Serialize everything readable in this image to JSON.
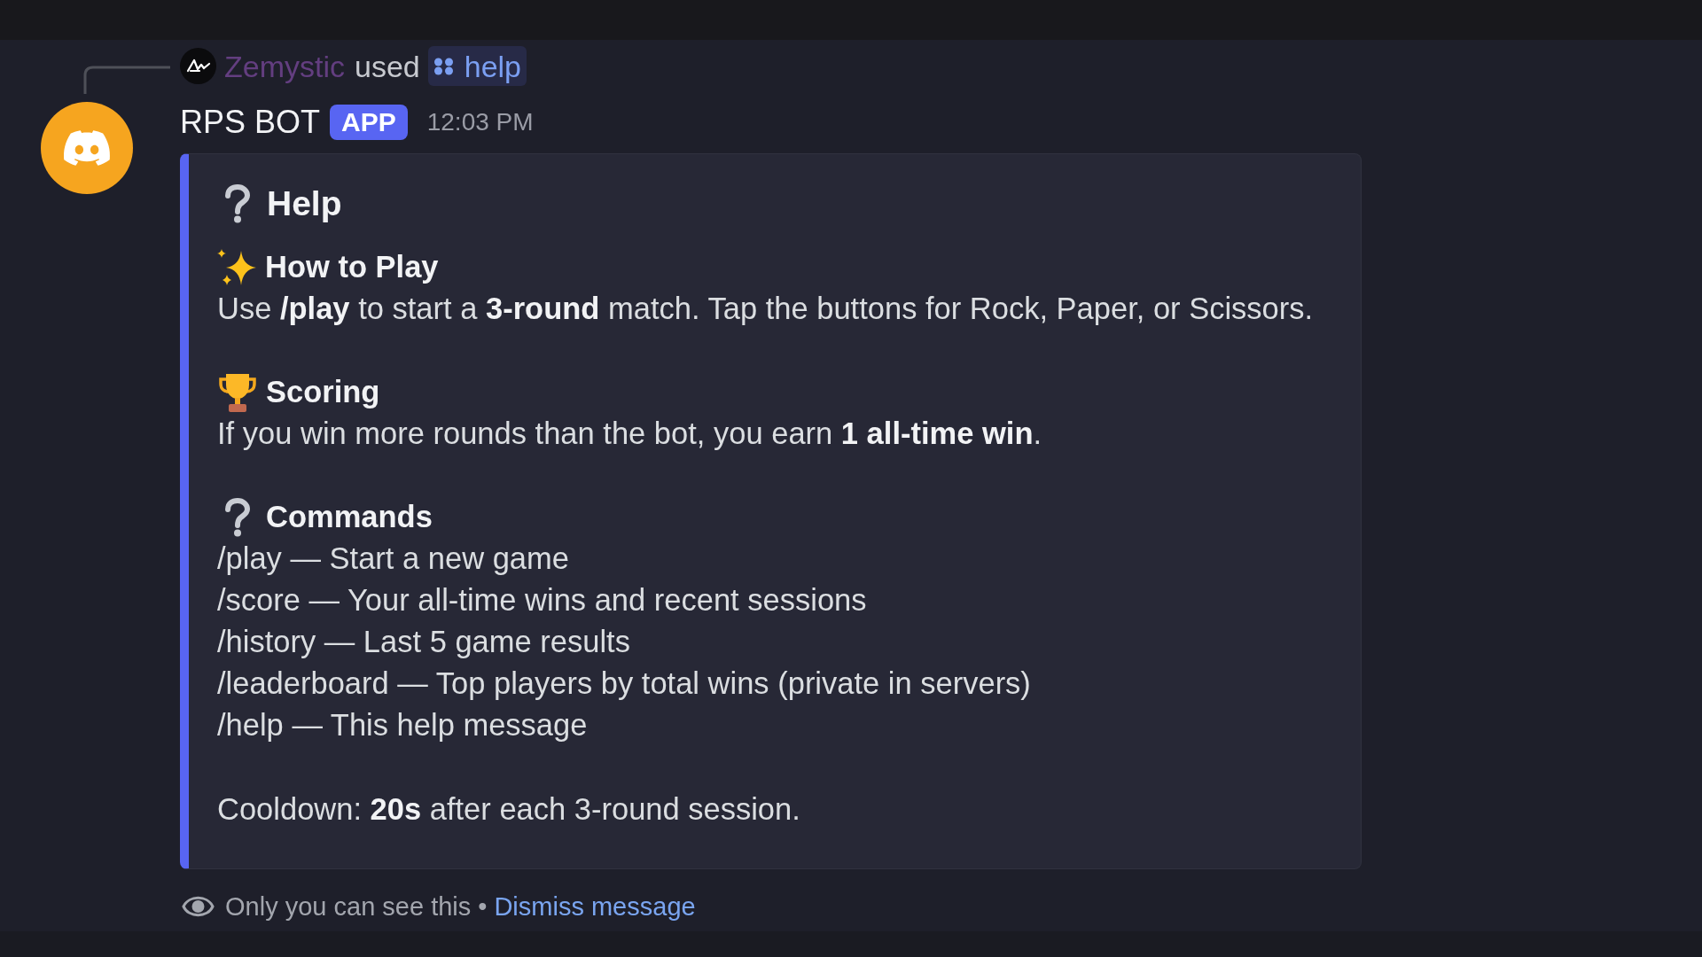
{
  "reply": {
    "user": "Zemystic",
    "action": "used",
    "command": "help"
  },
  "message": {
    "author": "RPS BOT",
    "badge": "APP",
    "timestamp": "12:03 PM",
    "embed": {
      "title": "Help",
      "fields": [
        {
          "kind": "sparkles",
          "name": "How to Play",
          "lines": [
            "Use **/play** to start a **3-round** match. Tap the buttons for Rock, Paper, or Scissors."
          ]
        },
        {
          "kind": "trophy",
          "name": "Scoring",
          "lines": [
            "If you win more rounds than the bot, you earn **1 all-time win**."
          ]
        },
        {
          "kind": "question",
          "name": "Commands",
          "lines": [
            "/play — Start a new game",
            "/score — Your all-time wins and recent sessions",
            "/history — Last 5 game results",
            "/leaderboard — Top players by total wins (private in servers)",
            "/help — This help message"
          ]
        }
      ],
      "note": "Cooldown: **20s** after each 3-round session."
    }
  },
  "ephemeral_notice": {
    "text": "Only you can see this",
    "separator": "•",
    "link": "Dismiss message"
  }
}
